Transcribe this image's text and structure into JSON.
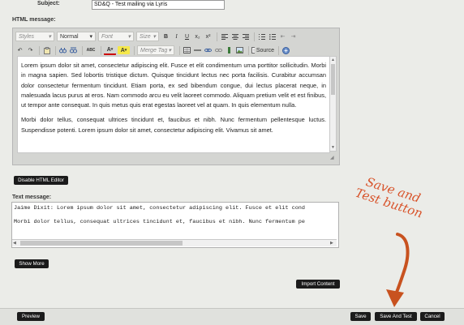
{
  "subject": {
    "label": "Subject:",
    "value": "SD&Q - Test mailing via Lyris"
  },
  "html_message": {
    "label": "HTML message:",
    "toolbar": {
      "styles_placeholder": "Styles",
      "format_value": "Normal",
      "font_placeholder": "Font",
      "size_placeholder": "Size",
      "merge_tag_placeholder": "Merge Tag",
      "source_label": "Source",
      "bold": "B",
      "italic": "I",
      "underline": "U",
      "subscript": "x₂",
      "superscript": "x²",
      "text_color": "A",
      "bg_color": "A",
      "spell": "ABC"
    },
    "paragraphs": [
      "Lorem ipsum dolor sit amet, consectetur adipiscing elit. Fusce et elit condimentum urna porttitor sollicitudin. Morbi in magna sapien. Sed lobortis tristique dictum. Quisque tincidunt lectus nec porta facilisis. Curabitur accumsan dolor consectetur fermentum tincidunt. Etiam porta, ex sed bibendum congue, dui lectus placerat neque, in malesuada lacus purus at eros. Nam commodo arcu eu velit laoreet commodo. Aliquam pretium velit et est finibus, ut tempor ante consequat. In quis metus quis erat egestas laoreet vel at quam. In quis elementum nulla.",
      "Morbi dolor tellus, consequat ultrices tincidunt et, faucibus et nibh. Nunc fermentum pellentesque luctus. Suspendisse potenti. Lorem ipsum dolor sit amet, consectetur adipiscing elit. Vivamus sit amet."
    ]
  },
  "disable_editor_label": "Disable HTML Editor",
  "text_message": {
    "label": "Text message:",
    "line1": "Jaime Dixit: Lorem ipsum dolor sit amet, consectetur adipiscing elit. Fusce et elit cond",
    "line2": "Morbi dolor tellus, consequat ultrices tincidunt et, faucibus et nibh. Nunc fermentum pe"
  },
  "show_more_label": "Show More",
  "import_content_label": "Import Content",
  "annotation_text": "Save and Test button",
  "footer": {
    "preview_label": "Preview",
    "save_label": "Save",
    "save_and_test_label": "Save And Test",
    "cancel_label": "Cancel"
  },
  "colors": {
    "annotation": "#d8532a",
    "button_bg": "#1b1b1b",
    "page_bg": "#ebece8"
  }
}
